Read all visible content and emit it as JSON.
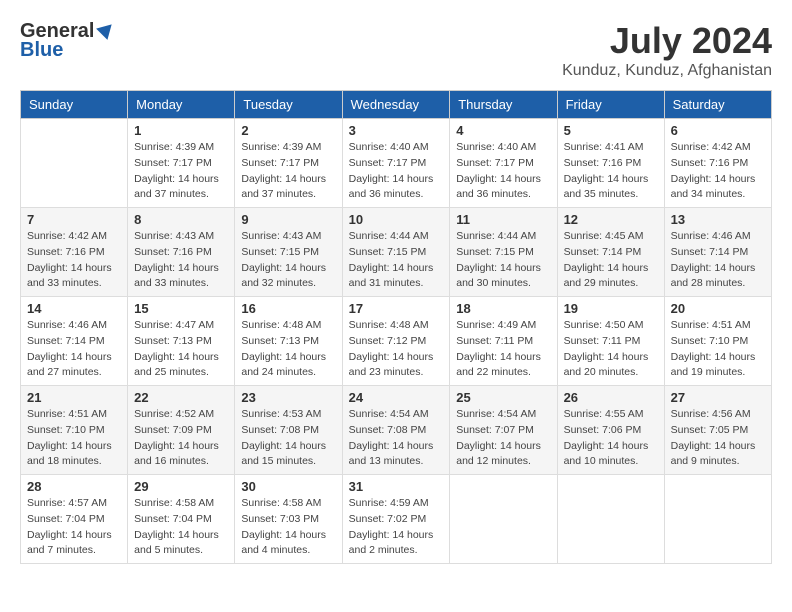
{
  "header": {
    "logo_general": "General",
    "logo_blue": "Blue",
    "month_year": "July 2024",
    "location": "Kunduz, Kunduz, Afghanistan"
  },
  "weekdays": [
    "Sunday",
    "Monday",
    "Tuesday",
    "Wednesday",
    "Thursday",
    "Friday",
    "Saturday"
  ],
  "weeks": [
    [
      {
        "day": "",
        "info": ""
      },
      {
        "day": "1",
        "info": "Sunrise: 4:39 AM\nSunset: 7:17 PM\nDaylight: 14 hours\nand 37 minutes."
      },
      {
        "day": "2",
        "info": "Sunrise: 4:39 AM\nSunset: 7:17 PM\nDaylight: 14 hours\nand 37 minutes."
      },
      {
        "day": "3",
        "info": "Sunrise: 4:40 AM\nSunset: 7:17 PM\nDaylight: 14 hours\nand 36 minutes."
      },
      {
        "day": "4",
        "info": "Sunrise: 4:40 AM\nSunset: 7:17 PM\nDaylight: 14 hours\nand 36 minutes."
      },
      {
        "day": "5",
        "info": "Sunrise: 4:41 AM\nSunset: 7:16 PM\nDaylight: 14 hours\nand 35 minutes."
      },
      {
        "day": "6",
        "info": "Sunrise: 4:42 AM\nSunset: 7:16 PM\nDaylight: 14 hours\nand 34 minutes."
      }
    ],
    [
      {
        "day": "7",
        "info": "Sunrise: 4:42 AM\nSunset: 7:16 PM\nDaylight: 14 hours\nand 33 minutes."
      },
      {
        "day": "8",
        "info": "Sunrise: 4:43 AM\nSunset: 7:16 PM\nDaylight: 14 hours\nand 33 minutes."
      },
      {
        "day": "9",
        "info": "Sunrise: 4:43 AM\nSunset: 7:15 PM\nDaylight: 14 hours\nand 32 minutes."
      },
      {
        "day": "10",
        "info": "Sunrise: 4:44 AM\nSunset: 7:15 PM\nDaylight: 14 hours\nand 31 minutes."
      },
      {
        "day": "11",
        "info": "Sunrise: 4:44 AM\nSunset: 7:15 PM\nDaylight: 14 hours\nand 30 minutes."
      },
      {
        "day": "12",
        "info": "Sunrise: 4:45 AM\nSunset: 7:14 PM\nDaylight: 14 hours\nand 29 minutes."
      },
      {
        "day": "13",
        "info": "Sunrise: 4:46 AM\nSunset: 7:14 PM\nDaylight: 14 hours\nand 28 minutes."
      }
    ],
    [
      {
        "day": "14",
        "info": "Sunrise: 4:46 AM\nSunset: 7:14 PM\nDaylight: 14 hours\nand 27 minutes."
      },
      {
        "day": "15",
        "info": "Sunrise: 4:47 AM\nSunset: 7:13 PM\nDaylight: 14 hours\nand 25 minutes."
      },
      {
        "day": "16",
        "info": "Sunrise: 4:48 AM\nSunset: 7:13 PM\nDaylight: 14 hours\nand 24 minutes."
      },
      {
        "day": "17",
        "info": "Sunrise: 4:48 AM\nSunset: 7:12 PM\nDaylight: 14 hours\nand 23 minutes."
      },
      {
        "day": "18",
        "info": "Sunrise: 4:49 AM\nSunset: 7:11 PM\nDaylight: 14 hours\nand 22 minutes."
      },
      {
        "day": "19",
        "info": "Sunrise: 4:50 AM\nSunset: 7:11 PM\nDaylight: 14 hours\nand 20 minutes."
      },
      {
        "day": "20",
        "info": "Sunrise: 4:51 AM\nSunset: 7:10 PM\nDaylight: 14 hours\nand 19 minutes."
      }
    ],
    [
      {
        "day": "21",
        "info": "Sunrise: 4:51 AM\nSunset: 7:10 PM\nDaylight: 14 hours\nand 18 minutes."
      },
      {
        "day": "22",
        "info": "Sunrise: 4:52 AM\nSunset: 7:09 PM\nDaylight: 14 hours\nand 16 minutes."
      },
      {
        "day": "23",
        "info": "Sunrise: 4:53 AM\nSunset: 7:08 PM\nDaylight: 14 hours\nand 15 minutes."
      },
      {
        "day": "24",
        "info": "Sunrise: 4:54 AM\nSunset: 7:08 PM\nDaylight: 14 hours\nand 13 minutes."
      },
      {
        "day": "25",
        "info": "Sunrise: 4:54 AM\nSunset: 7:07 PM\nDaylight: 14 hours\nand 12 minutes."
      },
      {
        "day": "26",
        "info": "Sunrise: 4:55 AM\nSunset: 7:06 PM\nDaylight: 14 hours\nand 10 minutes."
      },
      {
        "day": "27",
        "info": "Sunrise: 4:56 AM\nSunset: 7:05 PM\nDaylight: 14 hours\nand 9 minutes."
      }
    ],
    [
      {
        "day": "28",
        "info": "Sunrise: 4:57 AM\nSunset: 7:04 PM\nDaylight: 14 hours\nand 7 minutes."
      },
      {
        "day": "29",
        "info": "Sunrise: 4:58 AM\nSunset: 7:04 PM\nDaylight: 14 hours\nand 5 minutes."
      },
      {
        "day": "30",
        "info": "Sunrise: 4:58 AM\nSunset: 7:03 PM\nDaylight: 14 hours\nand 4 minutes."
      },
      {
        "day": "31",
        "info": "Sunrise: 4:59 AM\nSunset: 7:02 PM\nDaylight: 14 hours\nand 2 minutes."
      },
      {
        "day": "",
        "info": ""
      },
      {
        "day": "",
        "info": ""
      },
      {
        "day": "",
        "info": ""
      }
    ]
  ]
}
